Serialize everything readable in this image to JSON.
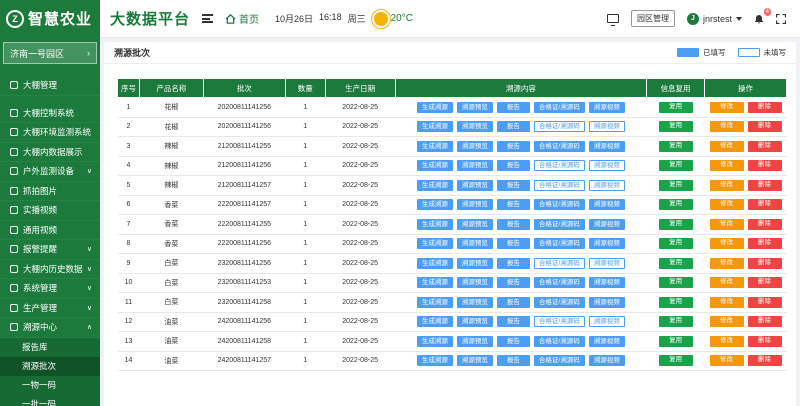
{
  "header": {
    "logo_text": "智慧农业",
    "logo_mark": "Z",
    "platform_title": "大数据平台",
    "home_label": "首页",
    "date": "10月26日",
    "time": "16:18",
    "weekday": "周三",
    "temperature": "20°C",
    "park_mgmt_label": "园区管理",
    "avatar_letter": "J",
    "username": "jnrstest",
    "notification_count": "4"
  },
  "sidebar": {
    "park_name": "济南一号园区",
    "items": [
      {
        "label": "大棚管理",
        "arrow": ""
      },
      {
        "label": "大棚控制系统",
        "arrow": ""
      },
      {
        "label": "大棚环境监测系统",
        "arrow": ""
      },
      {
        "label": "大棚内数据展示",
        "arrow": ""
      },
      {
        "label": "户外监测设备",
        "arrow": "∨"
      },
      {
        "label": "抓拍图片",
        "arrow": ""
      },
      {
        "label": "实播视频",
        "arrow": ""
      },
      {
        "label": "通用视频",
        "arrow": ""
      },
      {
        "label": "报警提醒",
        "arrow": "∨"
      },
      {
        "label": "大棚内历史数据",
        "arrow": "∨"
      },
      {
        "label": "系统管理",
        "arrow": "∨"
      },
      {
        "label": "生产管理",
        "arrow": "∨"
      },
      {
        "label": "溯源中心",
        "arrow": "∧"
      }
    ],
    "sub_items": [
      "报告库",
      "溯源批次",
      "一物一码",
      "一批一码"
    ]
  },
  "main": {
    "title": "溯源批次",
    "legend_filled": "已填写",
    "legend_empty": "未填写",
    "columns": [
      "序号",
      "产品名称",
      "批次",
      "数量",
      "生产日期",
      "溯源内容",
      "信息复用",
      "操作"
    ],
    "btn_labels": {
      "gen": "生成溯源",
      "preview": "溯源预览",
      "report": "报告",
      "cert": "合格证/溯源码",
      "video": "溯源视频",
      "reuse": "复用",
      "edit": "修改",
      "delete": "删除"
    },
    "rows": [
      {
        "no": "1",
        "name": "花椒",
        "batch": "20200811141256",
        "qty": "1",
        "date": "2022-08-25",
        "cert_filled": true,
        "video_filled": true
      },
      {
        "no": "2",
        "name": "花椒",
        "batch": "20200811141256",
        "qty": "1",
        "date": "2022-08-25",
        "cert_filled": false,
        "video_filled": false
      },
      {
        "no": "3",
        "name": "辣椒",
        "batch": "21200811141255",
        "qty": "1",
        "date": "2022-08-25",
        "cert_filled": true,
        "video_filled": true
      },
      {
        "no": "4",
        "name": "辣椒",
        "batch": "21200811141256",
        "qty": "1",
        "date": "2022-08-25",
        "cert_filled": false,
        "video_filled": false
      },
      {
        "no": "5",
        "name": "辣椒",
        "batch": "21200811141257",
        "qty": "1",
        "date": "2022-08-25",
        "cert_filled": false,
        "video_filled": false
      },
      {
        "no": "6",
        "name": "香菜",
        "batch": "22200811141257",
        "qty": "1",
        "date": "2022-08-25",
        "cert_filled": true,
        "video_filled": true
      },
      {
        "no": "7",
        "name": "香菜",
        "batch": "22200811141255",
        "qty": "1",
        "date": "2022-08-25",
        "cert_filled": true,
        "video_filled": true
      },
      {
        "no": "8",
        "name": "香菜",
        "batch": "22200811141256",
        "qty": "1",
        "date": "2022-08-25",
        "cert_filled": true,
        "video_filled": true
      },
      {
        "no": "9",
        "name": "白菜",
        "batch": "23200811141256",
        "qty": "1",
        "date": "2022-08-25",
        "cert_filled": false,
        "video_filled": false
      },
      {
        "no": "10",
        "name": "白菜",
        "batch": "23200811141253",
        "qty": "1",
        "date": "2022-08-25",
        "cert_filled": true,
        "video_filled": true
      },
      {
        "no": "11",
        "name": "白菜",
        "batch": "23200811141258",
        "qty": "1",
        "date": "2022-08-25",
        "cert_filled": true,
        "video_filled": true
      },
      {
        "no": "12",
        "name": "油菜",
        "batch": "24200811141256",
        "qty": "1",
        "date": "2022-08-25",
        "cert_filled": false,
        "video_filled": false
      },
      {
        "no": "13",
        "name": "油菜",
        "batch": "24200811141258",
        "qty": "1",
        "date": "2022-08-25",
        "cert_filled": true,
        "video_filled": true
      },
      {
        "no": "14",
        "name": "油菜",
        "batch": "24200811141257",
        "qty": "1",
        "date": "2022-08-25",
        "cert_filled": true,
        "video_filled": true
      }
    ]
  },
  "colors": {
    "brand_green": "#1c7a3c",
    "filled_blue": "#4c9ef5",
    "reuse_green": "#1aa34a",
    "edit_orange": "#f5980d",
    "delete_red": "#f04343"
  }
}
